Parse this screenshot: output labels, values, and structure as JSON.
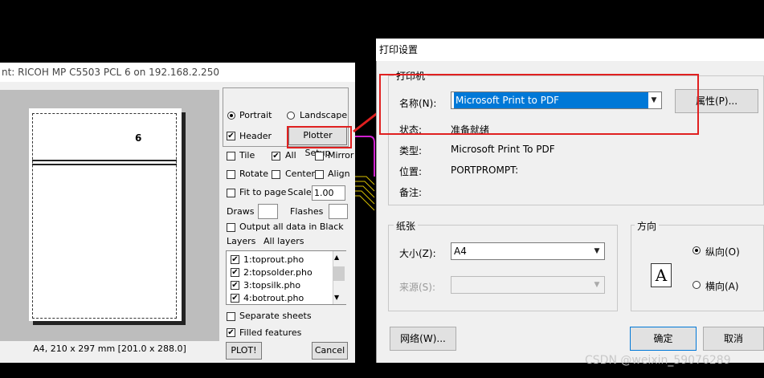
{
  "left_window": {
    "title": "nt: RICOH MP C5503 PCL 6 on 192.168.2.250",
    "page_number": "6",
    "paper_caption": "A4, 210 x 297 mm [201.0 x 288.0]",
    "portrait_label": "Portrait",
    "landscape_label": "Landscape",
    "header_label": "Header",
    "plotter_setup_label": "Plotter Setup",
    "tile_label": "Tile",
    "all_label": "All",
    "mirror_label": "Mirror",
    "rotate_label": "Rotate",
    "center_label": "Center",
    "align_label": "Align",
    "fit_label": "Fit to page",
    "scale_label": "Scale",
    "scale_value": "1.00",
    "draws_label": "Draws",
    "flashes_label": "Flashes",
    "output_black_label": "Output all data in Black",
    "layers_label": "Layers",
    "all_layers_label": "All layers",
    "layers": [
      "1:toprout.pho",
      "2:topsolder.pho",
      "3:topsilk.pho",
      "4:botrout.pho"
    ],
    "separate_sheets_label": "Separate sheets",
    "filled_features_label": "Filled features",
    "plot_button": "PLOT!",
    "cancel_button": "Cancel"
  },
  "print_dialog": {
    "title": "打印设置",
    "printer_group": "打印机",
    "name_label": "名称(N):",
    "name_value": "Microsoft Print to PDF",
    "properties_button": "属性(P)...",
    "status_label": "状态:",
    "status_value": "准备就绪",
    "type_label": "类型:",
    "type_value": "Microsoft Print To PDF",
    "where_label": "位置:",
    "where_value": "PORTPROMPT:",
    "comment_label": "备注:",
    "paper_group": "纸张",
    "size_label": "大小(Z):",
    "size_value": "A4",
    "source_label": "来源(S):",
    "source_value": "",
    "orientation_group": "方向",
    "portrait_label": "纵向(O)",
    "landscape_label": "横向(A)",
    "orientation_icon_letter": "A",
    "network_button": "网络(W)...",
    "ok_button": "确定",
    "cancel_button": "取消"
  },
  "watermark": "CSDN @weixin_59076289",
  "colors": {
    "highlight": "#0078d7",
    "annotation_red": "#e02020",
    "pcb_magenta": "#d020d0",
    "pcb_yellow": "#d8c000"
  }
}
